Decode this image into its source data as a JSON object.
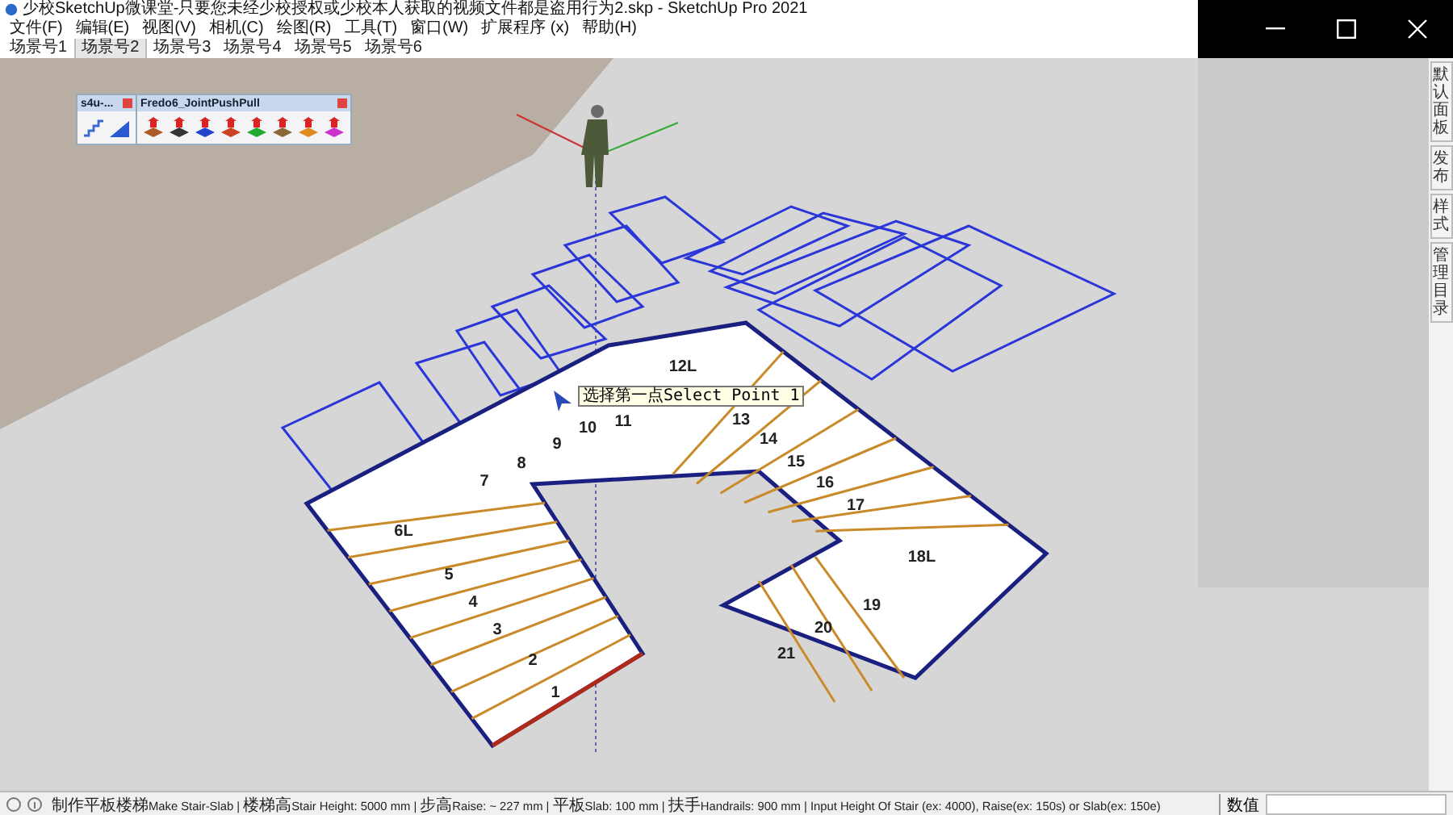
{
  "window": {
    "title": "少校SketchUp微课堂-只要您未经少校授权或少校本人获取的视频文件都是盗用行为2.skp - SketchUp Pro 2021"
  },
  "menu": [
    "文件(F)",
    "编辑(E)",
    "视图(V)",
    "相机(C)",
    "绘图(R)",
    "工具(T)",
    "窗口(W)",
    "扩展程序 (x)",
    "帮助(H)"
  ],
  "scenes": [
    {
      "label": "场景号1",
      "selected": false
    },
    {
      "label": "场景号2",
      "selected": true
    },
    {
      "label": "场景号3",
      "selected": false
    },
    {
      "label": "场景号4",
      "selected": false
    },
    {
      "label": "场景号5",
      "selected": false
    },
    {
      "label": "场景号6",
      "selected": false
    }
  ],
  "toolbars": [
    {
      "title": "s4u-...",
      "tools": [
        {
          "kind": "stair"
        },
        {
          "kind": "ramp"
        }
      ]
    },
    {
      "title": "Fredo6_JointPushPull",
      "tools": [
        {
          "kind": "push",
          "color": "#b05a2a"
        },
        {
          "kind": "push",
          "color": "#333333"
        },
        {
          "kind": "push",
          "color": "#2244cc"
        },
        {
          "kind": "push",
          "color": "#cc4422"
        },
        {
          "kind": "push",
          "color": "#22aa33"
        },
        {
          "kind": "push",
          "color": "#8a6a3a"
        },
        {
          "kind": "push",
          "color": "#e08a20"
        },
        {
          "kind": "push",
          "color": "#cc33cc"
        }
      ]
    }
  ],
  "viewport": {
    "tooltip": "选择第一点Select Point 1",
    "step_labels": [
      "1",
      "2",
      "3",
      "4",
      "5",
      "6L",
      "7",
      "8",
      "9",
      "10",
      "11",
      "12L",
      "13",
      "14",
      "15",
      "16",
      "17",
      "18L",
      "19",
      "20",
      "21"
    ]
  },
  "side_panel": {
    "tabs": [
      "默认面板",
      "发布",
      "样式",
      "管理目录"
    ]
  },
  "status_bar": {
    "text": "制作平板楼梯Make Stair-Slab | 楼梯高Stair Height: 5000 mm | 步高Raise: ~ 227 mm | 平板Slab: 100 mm | 扶手Handrails: 900 mm | Input Height Of Stair (ex: 4000), Raise(ex: 150s) or Slab(ex: 150e)",
    "value_label": "数值"
  }
}
